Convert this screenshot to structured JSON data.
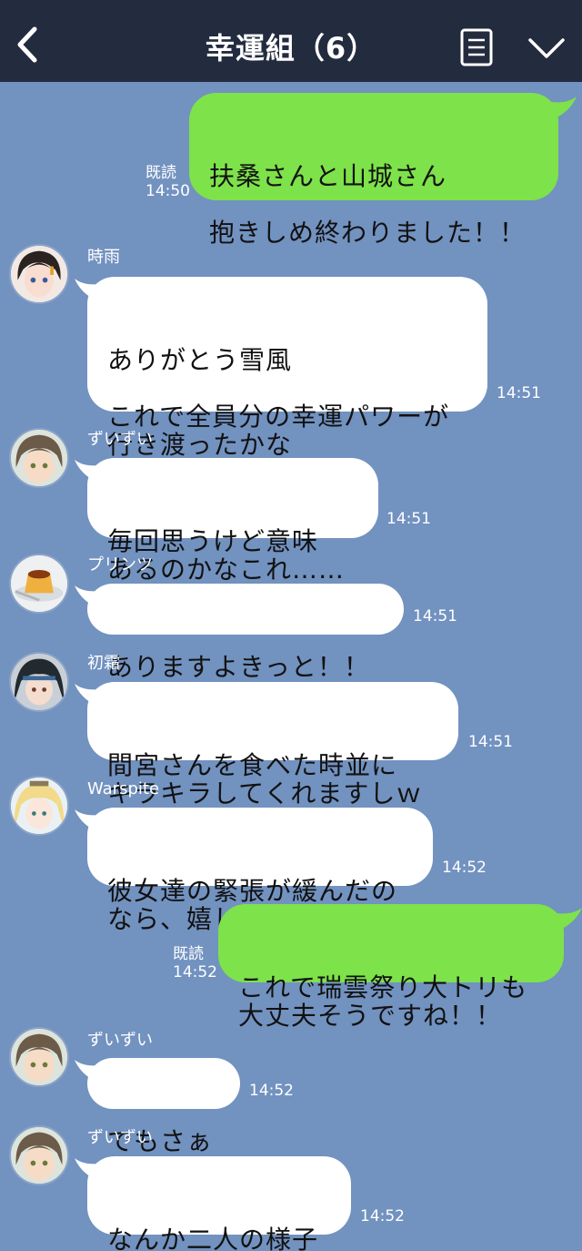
{
  "header": {
    "title": "幸運組（6）",
    "back_icon": "chevron-left-icon",
    "menu_icon": "list-icon",
    "expand_icon": "chevron-down-icon",
    "bg_color": "#232b3e"
  },
  "chat": {
    "bg_color": "#7292c0",
    "my_bubble_color": "#7ee24a",
    "their_bubble_color": "#ffffff",
    "messages": [
      {
        "from": "me",
        "text": "扶桑さんと山城さん\n\n抱きしめ終わりました！！",
        "read": "既読",
        "time": "14:50"
      },
      {
        "from": "時雨",
        "text": "ありがとう雪風\n\nこれで全員分の幸運パワーが\n行き渡ったかな",
        "time": "14:51"
      },
      {
        "from": "ずいずい",
        "text": "毎回思うけど意味\nあるのかなこれ……",
        "time": "14:51"
      },
      {
        "from": "プリンツ",
        "text": "ありますよきっと！！",
        "time": "14:51"
      },
      {
        "from": "初霜",
        "text": "間宮さんを食べた時並に\nキラキラしてくれますしｗ",
        "time": "14:51"
      },
      {
        "from": "Warspite",
        "text": "彼女達の緊張が緩んだの\nなら、嬉しいわ",
        "time": "14:52"
      },
      {
        "from": "me",
        "text": "これで瑞雲祭り大トリも\n大丈夫そうですね！！",
        "read": "既読",
        "time": "14:52"
      },
      {
        "from": "ずいずい",
        "text": "でもさぁ",
        "time": "14:52"
      },
      {
        "from": "ずいずい",
        "text": "なんか二人の様子\nおかしくない？",
        "time": "14:52"
      }
    ]
  }
}
